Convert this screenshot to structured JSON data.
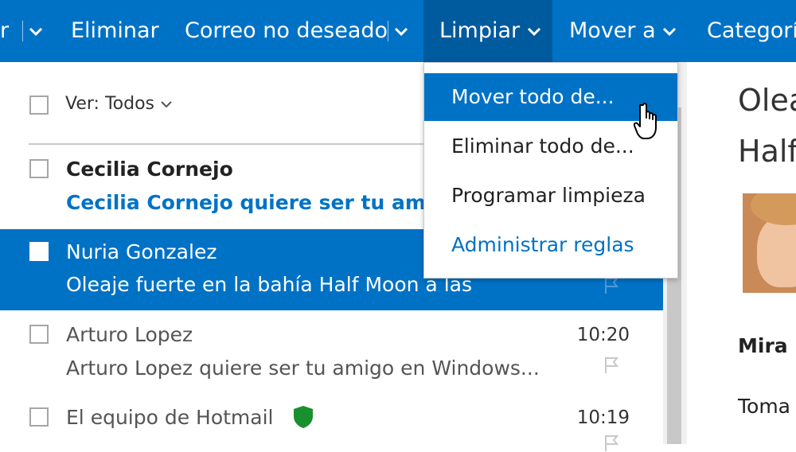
{
  "toolbar": {
    "cut_left": "r",
    "delete": "Eliminar",
    "junk": "Correo no deseado",
    "sweep": "Limpiar",
    "move_to": "Mover a",
    "categories": "Categorí"
  },
  "sweep_menu": {
    "items": [
      "Mover todo de...",
      "Eliminar todo de...",
      "Programar limpieza",
      "Administrar reglas"
    ]
  },
  "list": {
    "filter": "Ver: Todos",
    "messages": [
      {
        "sender": "Cecilia Cornejo",
        "subject": "Cecilia Cornejo quiere ser tu amigo",
        "time": ""
      },
      {
        "sender": "Nuria Gonzalez",
        "subject": "Oleaje fuerte en la bahía Half Moon a las",
        "time": ""
      },
      {
        "sender": "Arturo Lopez",
        "subject": "Arturo Lopez quiere ser tu amigo en Windows...",
        "time": "10:20"
      },
      {
        "sender": "El equipo de Hotmail",
        "subject": "",
        "time": "10:19"
      }
    ]
  },
  "reading": {
    "title_line1": "Olea",
    "title_line2": "Half",
    "body_line1": "Mira",
    "body_line2": "Toma"
  },
  "colors": {
    "accent": "#0072c6",
    "accent_dark": "#005a9e",
    "unread_subject": "#0072c6",
    "shield": "#1a8f2e"
  },
  "icons": [
    "chevron-down-icon",
    "shield-icon",
    "flag-icon",
    "hand-cursor-icon",
    "avatar"
  ]
}
